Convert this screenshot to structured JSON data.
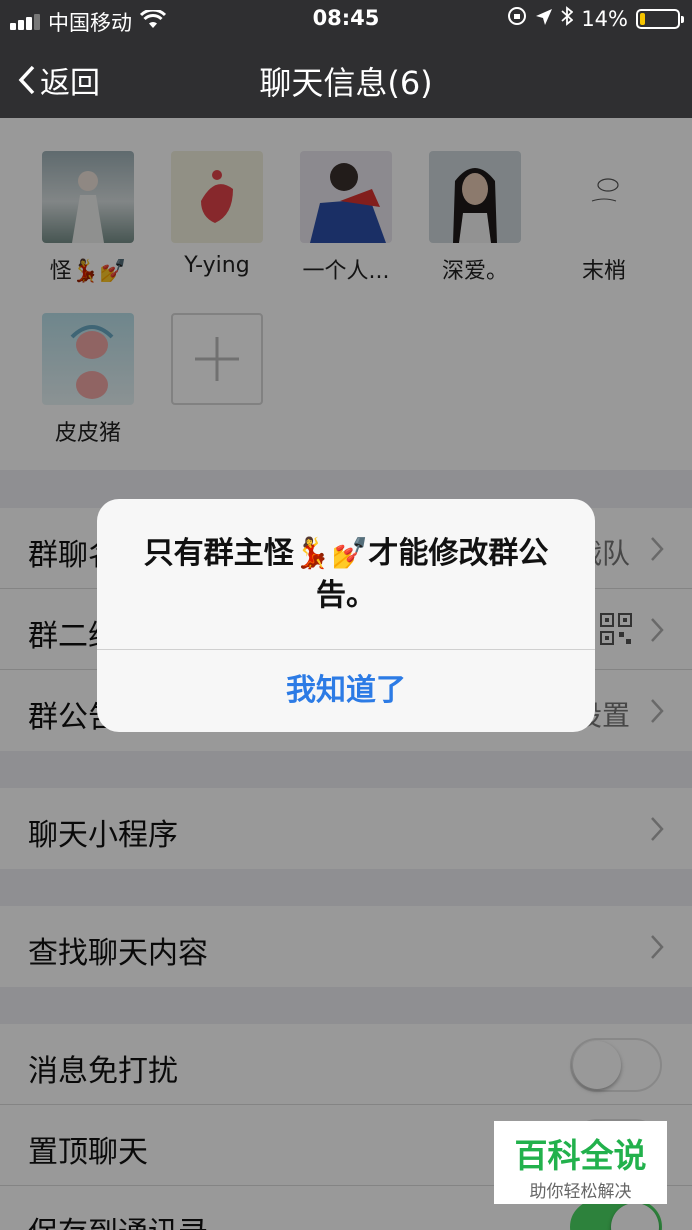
{
  "status_bar": {
    "carrier": "中国移动",
    "time": "08:45",
    "battery": "14%",
    "battery_level": 0.14
  },
  "nav": {
    "back_label": "返回",
    "title": "聊天信息(6)"
  },
  "members": [
    {
      "name": "怪💃💅"
    },
    {
      "name": "Y-ying"
    },
    {
      "name": "一个人..."
    },
    {
      "name": "深爱。"
    },
    {
      "name": "末梢"
    },
    {
      "name": "皮皮猪"
    }
  ],
  "settings": {
    "group_name": {
      "label": "群聊名称",
      "value": "战队"
    },
    "group_qr": {
      "label": "群二维码"
    },
    "group_notice": {
      "label": "群公告",
      "value": "未设置"
    },
    "mini_program": {
      "label": "聊天小程序"
    },
    "search_history": {
      "label": "查找聊天内容"
    },
    "mute": {
      "label": "消息免打扰",
      "on": false
    },
    "pin": {
      "label": "置顶聊天",
      "on": false
    },
    "save_contacts": {
      "label": "保存到通讯录",
      "on": true
    }
  },
  "alert": {
    "message": "只有群主怪💃💅才能修改群公告。",
    "button": "我知道了"
  },
  "watermark": {
    "main": "百科全说",
    "sub": "助你轻松解决"
  },
  "colors": {
    "accent": "#2c7be5",
    "toggle_on": "#4cd964",
    "nav_bg": "#2f2f31",
    "watermark": "#22b14c"
  }
}
